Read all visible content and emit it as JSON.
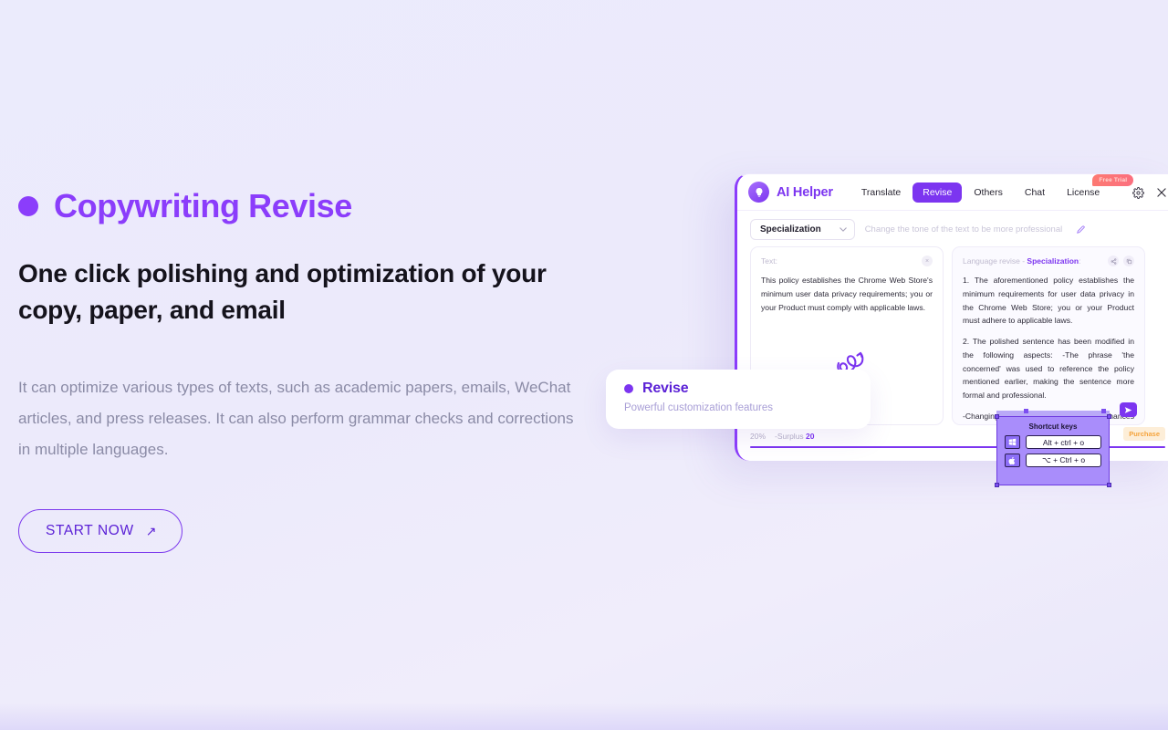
{
  "hero": {
    "eyebrow": "Copywriting Revise",
    "headline": "One click polishing and optimization of your copy, paper, and email",
    "subcopy": "It can optimize various types of texts, such as academic papers, emails, WeChat articles, and press releases. It can also perform grammar checks and corrections in multiple languages.",
    "cta_label": "START NOW",
    "cta_arrow": "↗"
  },
  "colors": {
    "accent": "#7c35f0",
    "accent_dark": "#5b21d6",
    "background": "#ebebfc",
    "muted_text": "#8b8ba6",
    "badge_trial": "#fb6f7f",
    "badge_purchase": "#f5a33c"
  },
  "app": {
    "brand_name": "AI Helper",
    "tabs": [
      {
        "label": "Translate",
        "active": false
      },
      {
        "label": "Revise",
        "active": true
      },
      {
        "label": "Others",
        "active": false
      },
      {
        "label": "Chat",
        "active": false
      },
      {
        "label": "License",
        "active": false
      }
    ],
    "trial_badge": "Free Trial",
    "toolbar": {
      "select_value": "Specialization",
      "caret": "⌄",
      "hint": "Change the tone of the text to be more professional"
    },
    "left_panel": {
      "label": "Text:",
      "clear_glyph": "×",
      "body": "This policy establishes the Chrome Web Store's minimum user data privacy requirements; you or your Product must comply with applicable laws."
    },
    "right_panel": {
      "label_prefix": "Language revise - ",
      "label_accent": "Specialization",
      "label_suffix": ":",
      "paragraphs": [
        "1. The aforementioned policy establishes the minimum requirements for user data privacy in the Chrome Web Store; you or your Product must adhere to applicable laws.",
        "2. The polished sentence has been modified in the following aspects:\n-The phrase 'the concerned' was used to reference the policy mentioned earlier, making the sentence more formal and professional.",
        "-Changing 'complex with' to 'adhere to' enhances the rigor of expression."
      ]
    },
    "footer": {
      "usage_pct": "20%",
      "surplus_label": "-Surplus",
      "surplus_value": "20",
      "purchase_label": "Purchase"
    }
  },
  "revise_card": {
    "title": "Revise",
    "subtitle": "Powerful customization features"
  },
  "shortcut_popup": {
    "title": "Shortcut keys",
    "rows": [
      {
        "os": "windows",
        "keys": "Alt + ctrl + o"
      },
      {
        "os": "apple",
        "keys": "⌥ + Ctrl + o"
      }
    ]
  }
}
